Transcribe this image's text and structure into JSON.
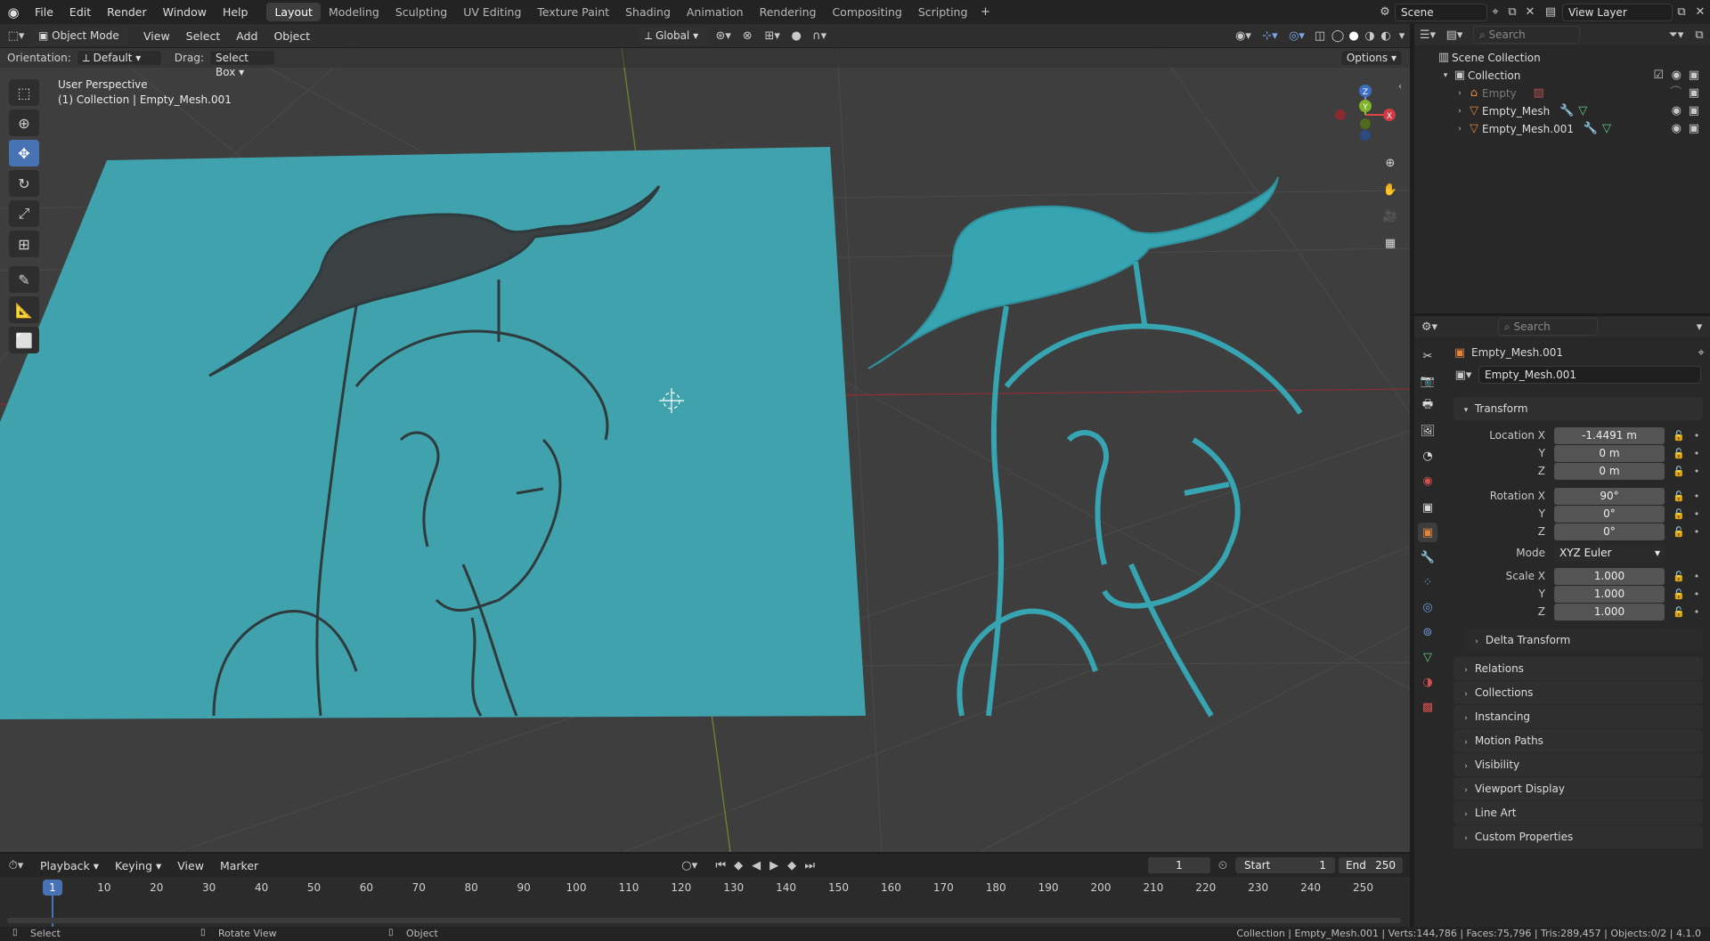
{
  "topbar": {
    "menus": [
      "File",
      "Edit",
      "Render",
      "Window",
      "Help"
    ],
    "workspaces": [
      "Layout",
      "Modeling",
      "Sculpting",
      "UV Editing",
      "Texture Paint",
      "Shading",
      "Animation",
      "Rendering",
      "Compositing",
      "Scripting"
    ],
    "active_workspace": "Layout",
    "scene": "Scene",
    "view_layer": "View Layer"
  },
  "viewport_header": {
    "mode": "Object Mode",
    "menus": [
      "View",
      "Select",
      "Add",
      "Object"
    ],
    "transform_orientation": "Global",
    "orientation_label": "Orientation:",
    "orientation_value": "Default",
    "drag_label": "Drag:",
    "drag_value": "Select Box",
    "options_label": "Options"
  },
  "viewport": {
    "perspective": "User Perspective",
    "context": "(1) Collection | Empty_Mesh.001",
    "plane_color": "#3fa3ae",
    "mesh_color": "#37a4b2",
    "axis_labels": {
      "z": "Z",
      "x": "X",
      "y": "Y"
    }
  },
  "outliner": {
    "search_placeholder": "Search",
    "root": "Scene Collection",
    "collection": "Collection",
    "items": [
      "Empty",
      "Empty_Mesh",
      "Empty_Mesh.001"
    ]
  },
  "properties": {
    "search_placeholder": "Search",
    "object_name": "Empty_Mesh.001",
    "object_field": "Empty_Mesh.001",
    "transform_label": "Transform",
    "location_label": "Location X",
    "location": {
      "x": "-1.4491 m",
      "y": "0 m",
      "z": "0 m"
    },
    "rotation_label": "Rotation X",
    "rotation": {
      "x": "90°",
      "y": "0°",
      "z": "0°"
    },
    "mode_label": "Mode",
    "mode_value": "XYZ Euler",
    "scale_label": "Scale X",
    "scale": {
      "x": "1.000",
      "y": "1.000",
      "z": "1.000"
    },
    "y_label": "Y",
    "z_label": "Z",
    "delta_transform": "Delta Transform",
    "sections": [
      "Relations",
      "Collections",
      "Instancing",
      "Motion Paths",
      "Visibility",
      "Viewport Display",
      "Line Art",
      "Custom Properties"
    ]
  },
  "timeline": {
    "menus": [
      "Playback",
      "Keying",
      "View",
      "Marker"
    ],
    "current_frame": "1",
    "start_label": "Start",
    "start": "1",
    "end_label": "End",
    "end": "250",
    "ticks": [
      "10",
      "20",
      "30",
      "40",
      "50",
      "60",
      "70",
      "80",
      "90",
      "100",
      "110",
      "120",
      "130",
      "140",
      "150",
      "160",
      "170",
      "180",
      "190",
      "200",
      "210",
      "220",
      "230",
      "240",
      "250"
    ],
    "playhead": "1"
  },
  "status": {
    "select": "Select",
    "rotate": "Rotate View",
    "object": "Object",
    "stats": "Collection | Empty_Mesh.001 | Verts:144,786 | Faces:75,796 | Tris:289,457 | Objects:0/2 | 4.1.0"
  }
}
